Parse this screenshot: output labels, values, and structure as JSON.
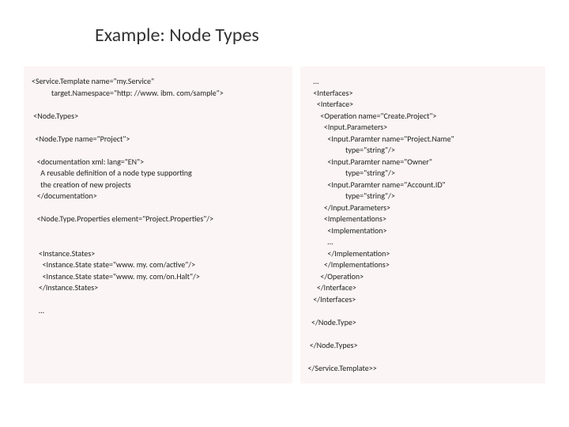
{
  "title": "Example: Node Types",
  "left": "<Service.Template name=\"my.Service\"\n           target.Namespace=\"http: //www. ibm. com/sample\">\n\n <Node.Types>\n\n  <Node.Type name=\"Project\">\n\n   <documentation xml: lang=\"EN\">\n     A reusable definition of a node type supporting\n     the creation of new projects\n   </documentation>\n\n   <Node.Type.Properties element=\"Project.Properties\"/>\n\n\n    <Instance.States>\n      <Instance.State state=\"www. my. com/active\"/>\n      <Instance.State state=\"www. my. com/on.Halt\"/>\n    </Instance.States>\n\n    …",
  "right": "   …\n   <Interfaces>\n     <Interface>\n       <Operation name=\"Create.Project\">\n         <Input.Parameters>\n           <Input.Paramter name=\"Project.Name\"\n                     type=\"string\"/>\n           <Input.Paramter name=\"Owner\"\n                     type=\"string\"/>\n           <Input.Paramter name=\"Account.ID\"\n                     type=\"string\"/>\n         </Input.Parameters>\n         <Implementations>\n           <Implementation>\n           …\n           </Implementation>\n         </Implementations>\n       </Operation>\n     </Interface>\n   </Interfaces>\n\n  </Node.Type>\n\n </Node.Types>\n\n</Service.Template>>"
}
